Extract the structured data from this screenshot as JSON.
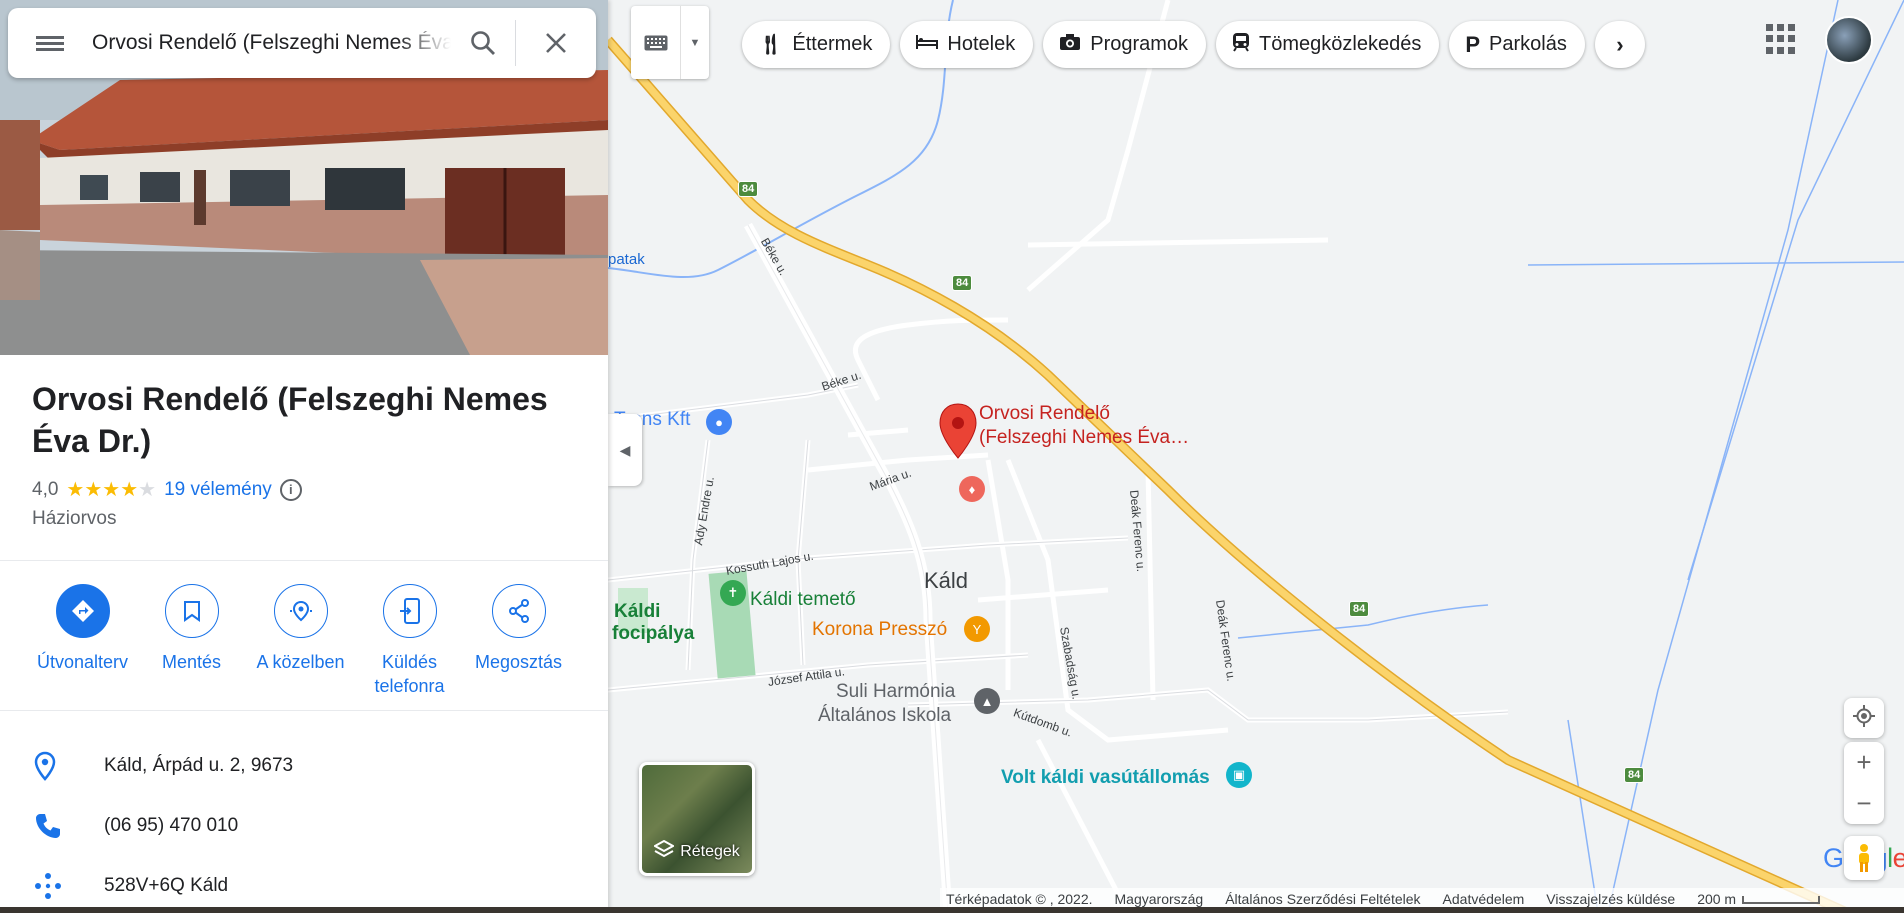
{
  "search": {
    "query": "Orvosi Rendelő (Felszeghi Nemes Éva Dr.)"
  },
  "place": {
    "title": "Orvosi Rendelő (Felszeghi Nemes Éva Dr.)",
    "rating": "4,0",
    "stars_filled": 4,
    "reviews": "19 vélemény",
    "category": "Háziorvos"
  },
  "actions": [
    {
      "label": "Útvonalterv",
      "icon": "directions-icon"
    },
    {
      "label": "Mentés",
      "icon": "bookmark-icon"
    },
    {
      "label": "A közelben",
      "icon": "nearby-icon"
    },
    {
      "label": "Küldés telefonra",
      "icon": "send-to-phone-icon"
    },
    {
      "label": "Megosztás",
      "icon": "share-icon"
    }
  ],
  "info": {
    "address": "Káld, Árpád u. 2, 9673",
    "phone": "(06 95) 470 010",
    "plus_code": "528V+6Q Káld"
  },
  "chips": [
    {
      "label": "Éttermek",
      "icon": "fork-knife-icon"
    },
    {
      "label": "Hotelek",
      "icon": "bed-icon"
    },
    {
      "label": "Programok",
      "icon": "camera-icon"
    },
    {
      "label": "Tömegközlekedés",
      "icon": "train-icon"
    },
    {
      "label": "Parkolás",
      "icon": "parking-icon"
    }
  ],
  "map": {
    "town": "Káld",
    "selected_place": "Orvosi Rendelő",
    "selected_place_line2": "(Felszeghi Nemes Éva…",
    "pois": {
      "cemetery": "Káldi temető",
      "bar": "Korona Presszó",
      "school_line1": "Suli Harmónia",
      "school_line2": "Általános Iskola",
      "station": "Volt káldi vasútállomás",
      "football_line1": "Káldi",
      "football_line2": "focipálya",
      "shop": "Trans Kft"
    },
    "streets": {
      "beke1": "Béke u.",
      "beke2": "Béke u.",
      "maria": "Mária u.",
      "ady": "Ady Endre u.",
      "kossuth": "Kossuth Lajos u.",
      "jozsef": "József Attila u.",
      "szabadsag": "Szabadság u.",
      "deak1": "Deák Ferenc u.",
      "deak2": "Deák Ferenc u.",
      "kutdomb": "Kútdomb u.",
      "patak": "patak"
    },
    "route_number": "84",
    "layers_label": "Rétegek",
    "logo": "Google"
  },
  "footer": {
    "mapdata": "Térképadatok © , 2022.",
    "country": "Magyarország",
    "terms": "Általános Szerződési Feltételek",
    "privacy": "Adatvédelem",
    "feedback": "Visszajelzés küldése",
    "scale": "200 m"
  },
  "colors": {
    "accent": "#1a73e8",
    "highway": "#f6c343",
    "pin": "#ea4335",
    "star": "#fbbc04"
  }
}
